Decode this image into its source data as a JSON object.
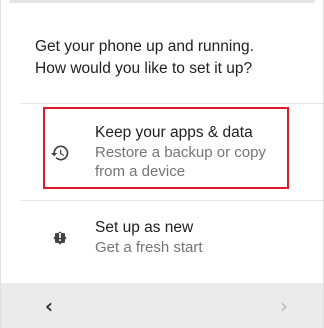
{
  "prompt": {
    "line1": "Get your phone up and running.",
    "line2": "How would you like to set it up?"
  },
  "options": [
    {
      "title": "Keep your apps & data",
      "subtitle_line1": "Restore a backup or copy",
      "subtitle_line2": "from a device",
      "icon": "restore-history-icon",
      "highlighted": true
    },
    {
      "title": "Set up as new",
      "subtitle_line1": "Get a fresh start",
      "icon": "new-device-icon",
      "highlighted": false
    }
  ],
  "nav": {
    "back_glyph": "‹",
    "next_glyph": "›"
  },
  "colors": {
    "highlight": "#e0192f",
    "nav_bar": "#ebebeb",
    "subtitle": "#757575"
  }
}
